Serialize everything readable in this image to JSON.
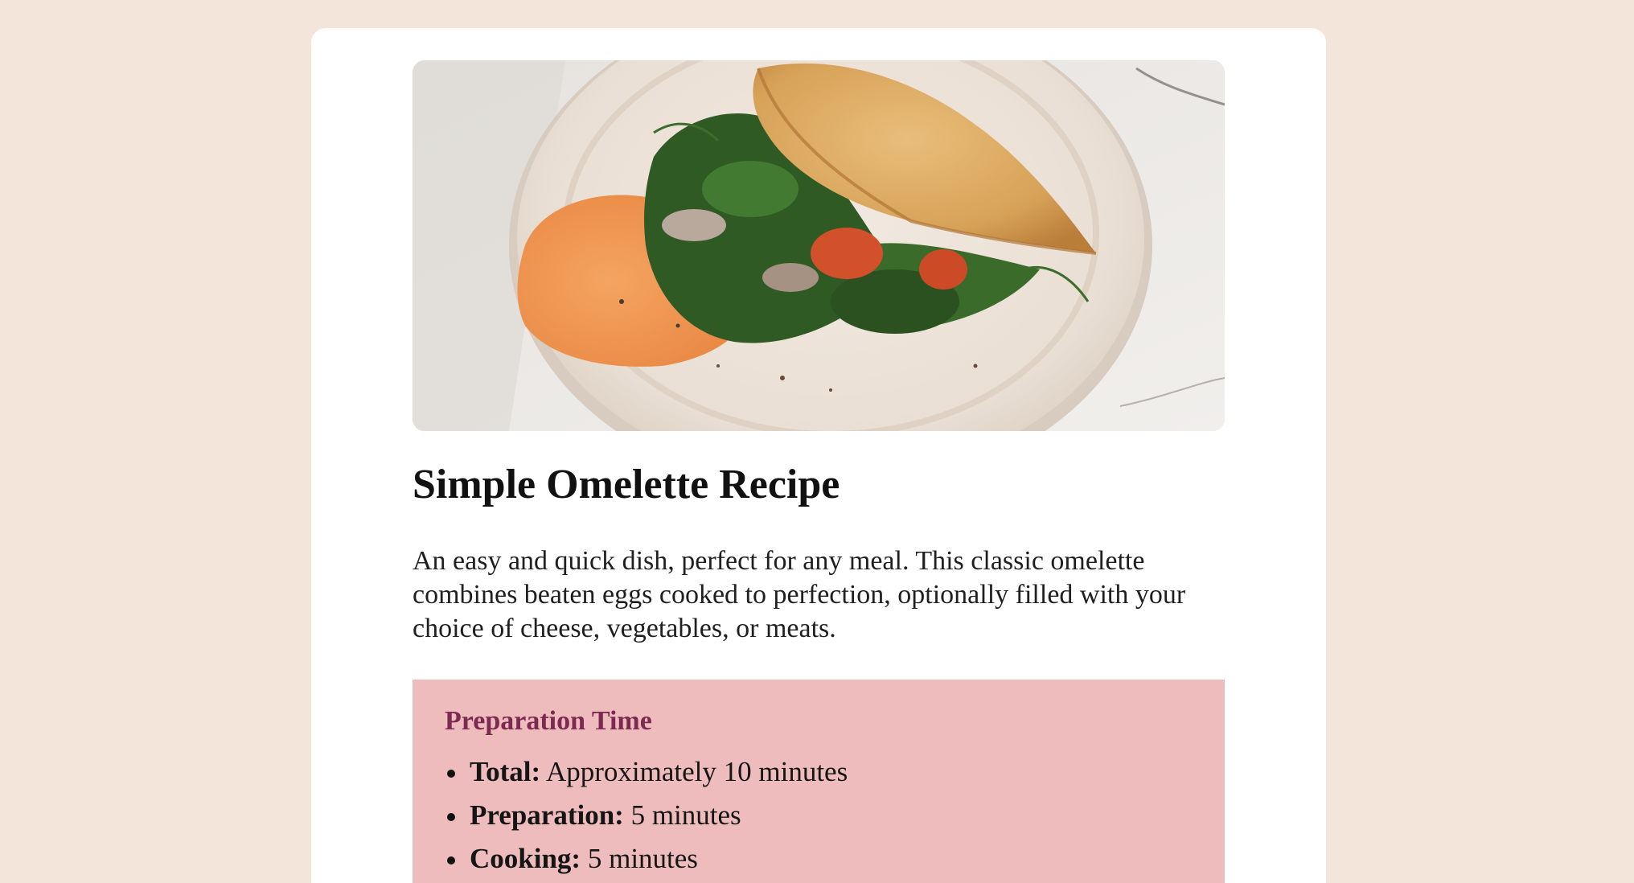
{
  "recipe": {
    "title": "Simple Omelette Recipe",
    "intro": "An easy and quick dish, perfect for any meal. This classic omelette combines beaten eggs cooked to perfection, optionally filled with your choice of cheese, vegetables, or meats.",
    "preparation": {
      "heading": "Preparation Time",
      "items": [
        {
          "label": "Total:",
          "value": " Approximately 10 minutes"
        },
        {
          "label": "Preparation:",
          "value": " 5 minutes"
        },
        {
          "label": "Cooking:",
          "value": " 5 minutes"
        }
      ]
    }
  },
  "colors": {
    "page_background": "#f3e5da",
    "card_background": "#ffffff",
    "prep_background": "#efbcbd",
    "prep_heading": "#7d2a52"
  },
  "image": {
    "subject": "omelette-on-plate-photo"
  }
}
